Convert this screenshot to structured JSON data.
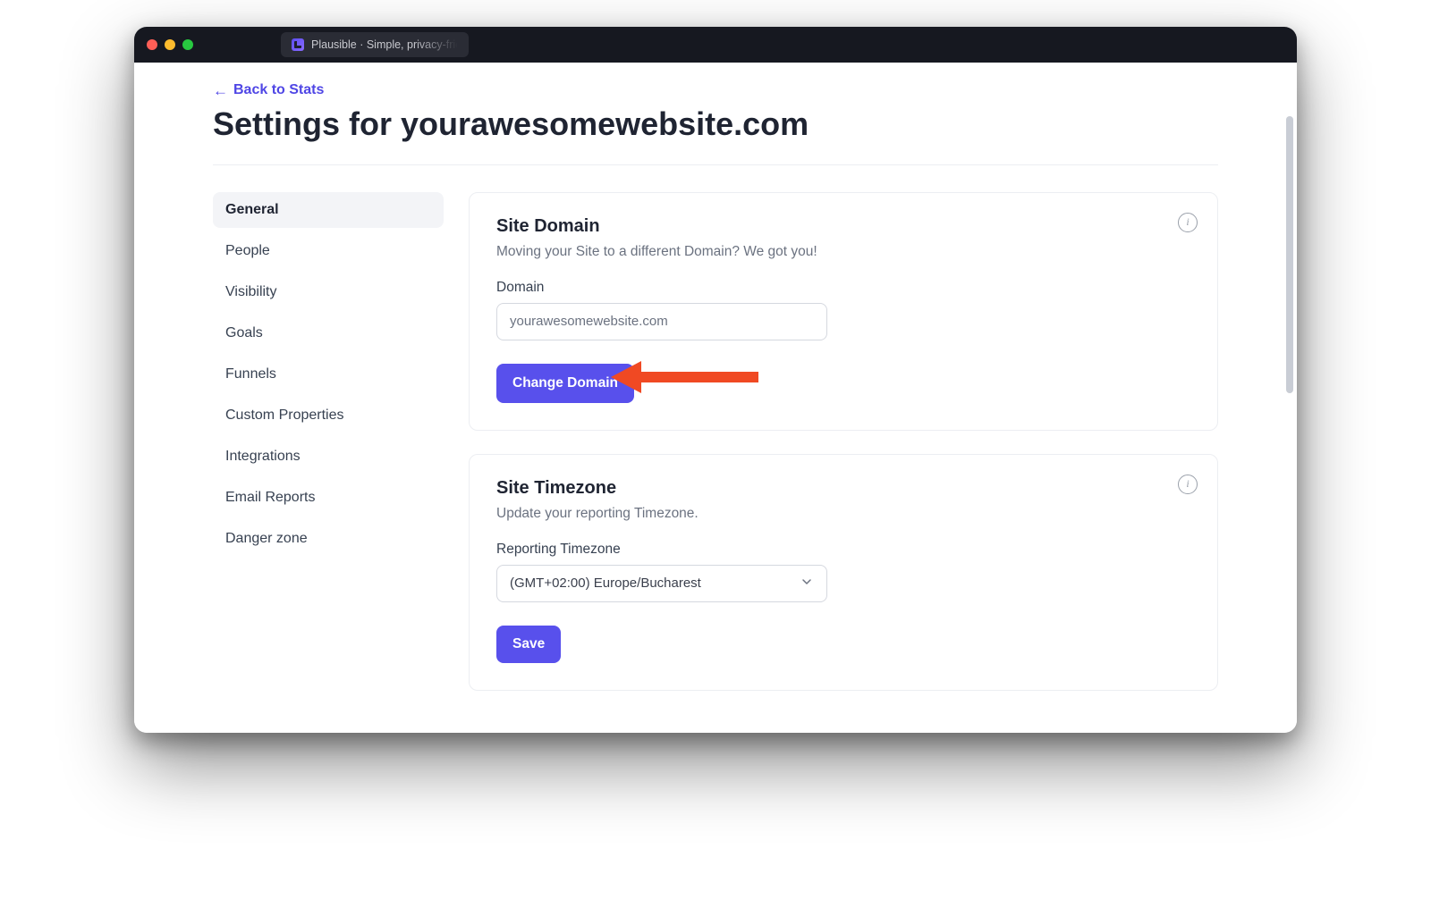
{
  "tab": {
    "label": "Plausible · Simple, privacy-frien"
  },
  "back_link": "Back to Stats",
  "page_title": "Settings for yourawesomewebsite.com",
  "sidebar": {
    "items": [
      {
        "label": "General",
        "active": true
      },
      {
        "label": "People"
      },
      {
        "label": "Visibility"
      },
      {
        "label": "Goals"
      },
      {
        "label": "Funnels"
      },
      {
        "label": "Custom Properties"
      },
      {
        "label": "Integrations"
      },
      {
        "label": "Email Reports"
      },
      {
        "label": "Danger zone"
      }
    ]
  },
  "domain_card": {
    "title": "Site Domain",
    "subtitle": "Moving your Site to a different Domain? We got you!",
    "field_label": "Domain",
    "field_value": "yourawesomewebsite.com",
    "button": "Change Domain"
  },
  "timezone_card": {
    "title": "Site Timezone",
    "subtitle": "Update your reporting Timezone.",
    "field_label": "Reporting Timezone",
    "selected": "(GMT+02:00) Europe/Bucharest",
    "button": "Save"
  }
}
